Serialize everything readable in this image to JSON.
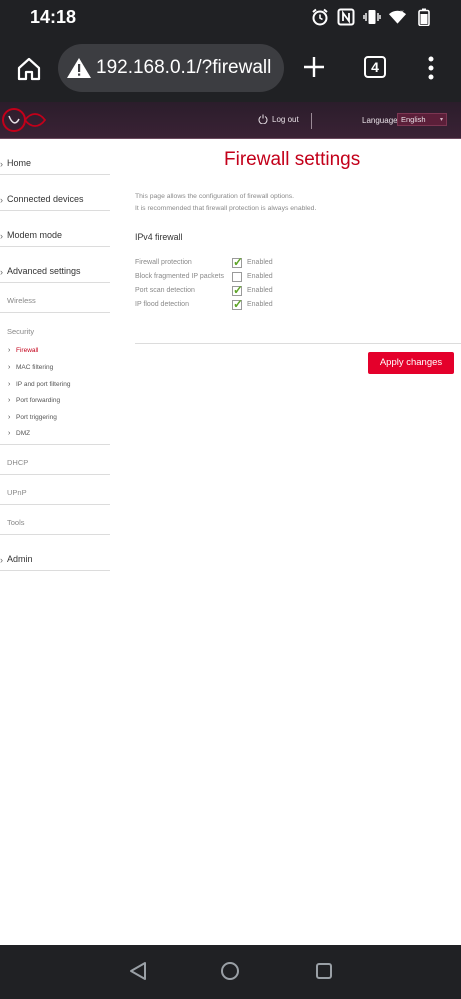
{
  "status_bar": {
    "time": "14:18",
    "icons": [
      "alarm-icon",
      "nfc-icon",
      "vibrate-icon",
      "wifi-icon",
      "battery-icon"
    ]
  },
  "browser": {
    "url": "192.168.0.1/?firewall",
    "tab_count": "4",
    "icons": [
      "home-icon",
      "warning-icon",
      "plus-icon",
      "tabs-icon",
      "overflow-menu-icon"
    ]
  },
  "header": {
    "logout_label": "Log out",
    "language_label": "Language",
    "language_value": "English",
    "brand_color": "#c3001a"
  },
  "sidebar": {
    "items": [
      {
        "label": "Home"
      },
      {
        "label": "Connected devices"
      },
      {
        "label": "Modem mode"
      },
      {
        "label": "Advanced settings"
      }
    ],
    "groups": {
      "wireless": "Wireless",
      "security": "Security",
      "dhcp": "DHCP",
      "upnp": "UPnP",
      "tools": "Tools"
    },
    "security_items": [
      {
        "label": "Firewall",
        "active": true
      },
      {
        "label": "MAC filtering"
      },
      {
        "label": "IP and port filtering"
      },
      {
        "label": "Port forwarding"
      },
      {
        "label": "Port triggering"
      },
      {
        "label": "DMZ"
      }
    ],
    "admin": "Admin"
  },
  "main": {
    "title": "Firewall settings",
    "description_line1": "This page allows the configuration of firewall options.",
    "description_line2": "It is recommended that firewall protection is always enabled.",
    "section_title": "IPv4 firewall",
    "options": [
      {
        "label": "Firewall protection",
        "checked": true,
        "state": "Enabled"
      },
      {
        "label": "Block fragmented IP packets",
        "checked": false,
        "state": "Enabled"
      },
      {
        "label": "Port scan detection",
        "checked": true,
        "state": "Enabled"
      },
      {
        "label": "IP flood detection",
        "checked": true,
        "state": "Enabled"
      }
    ],
    "apply_label": "Apply changes",
    "apply_color": "#e4002b"
  },
  "android_nav": {
    "icons": [
      "back-icon",
      "home-circle-icon",
      "recents-icon"
    ]
  }
}
